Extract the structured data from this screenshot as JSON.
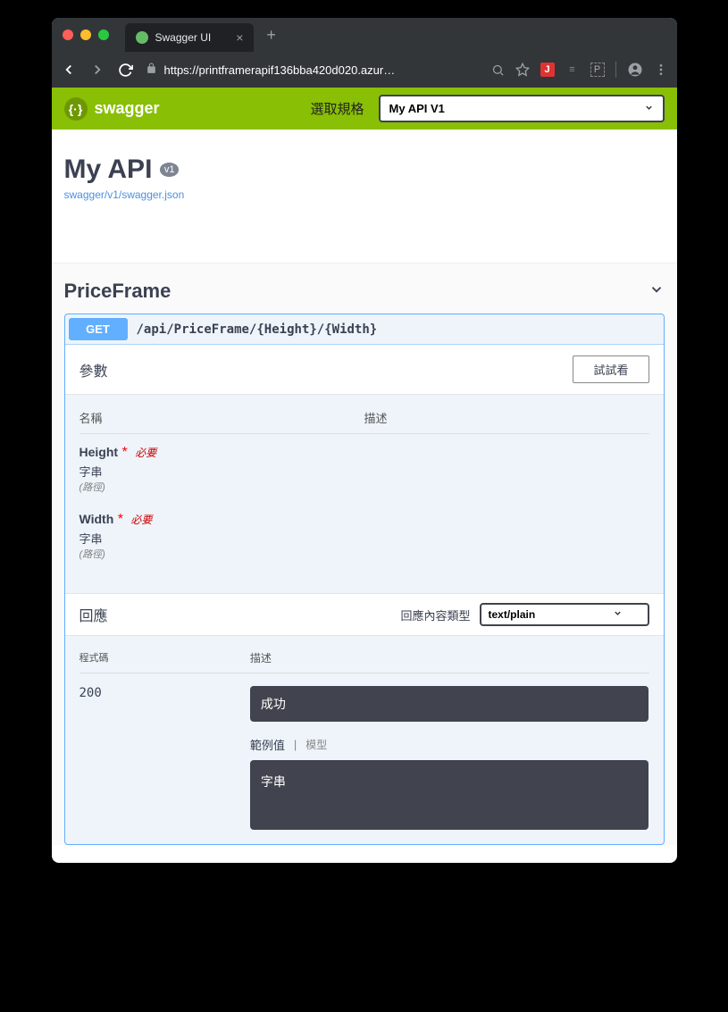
{
  "browser": {
    "tab_title": "Swagger UI",
    "url": "https://printframerapif136bba420d020.azur…"
  },
  "swagger_header": {
    "brand": "swagger",
    "spec_label": "選取規格",
    "spec_selected": "My API V1"
  },
  "api": {
    "title": "My API",
    "version": "v1",
    "json_link": "swagger/v1/swagger.json"
  },
  "tag": {
    "name": "PriceFrame"
  },
  "operation": {
    "method": "GET",
    "path": "/api/PriceFrame/{Height}/{Width}"
  },
  "params": {
    "title": "參數",
    "tryit": "試試看",
    "col_name": "名稱",
    "col_desc": "描述",
    "items": [
      {
        "name": "Height",
        "required": "必要",
        "type": "字串",
        "in": "(路徑)"
      },
      {
        "name": "Width",
        "required": "必要",
        "type": "字串",
        "in": "(路徑)"
      }
    ]
  },
  "responses": {
    "title": "回應",
    "content_type_label": "回應內容類型",
    "content_type": "text/plain",
    "col_code": "程式碼",
    "col_desc": "描述",
    "row": {
      "code": "200",
      "desc": "成功",
      "tab_example": "範例值",
      "tab_model": "模型",
      "example_body": "字串"
    }
  }
}
